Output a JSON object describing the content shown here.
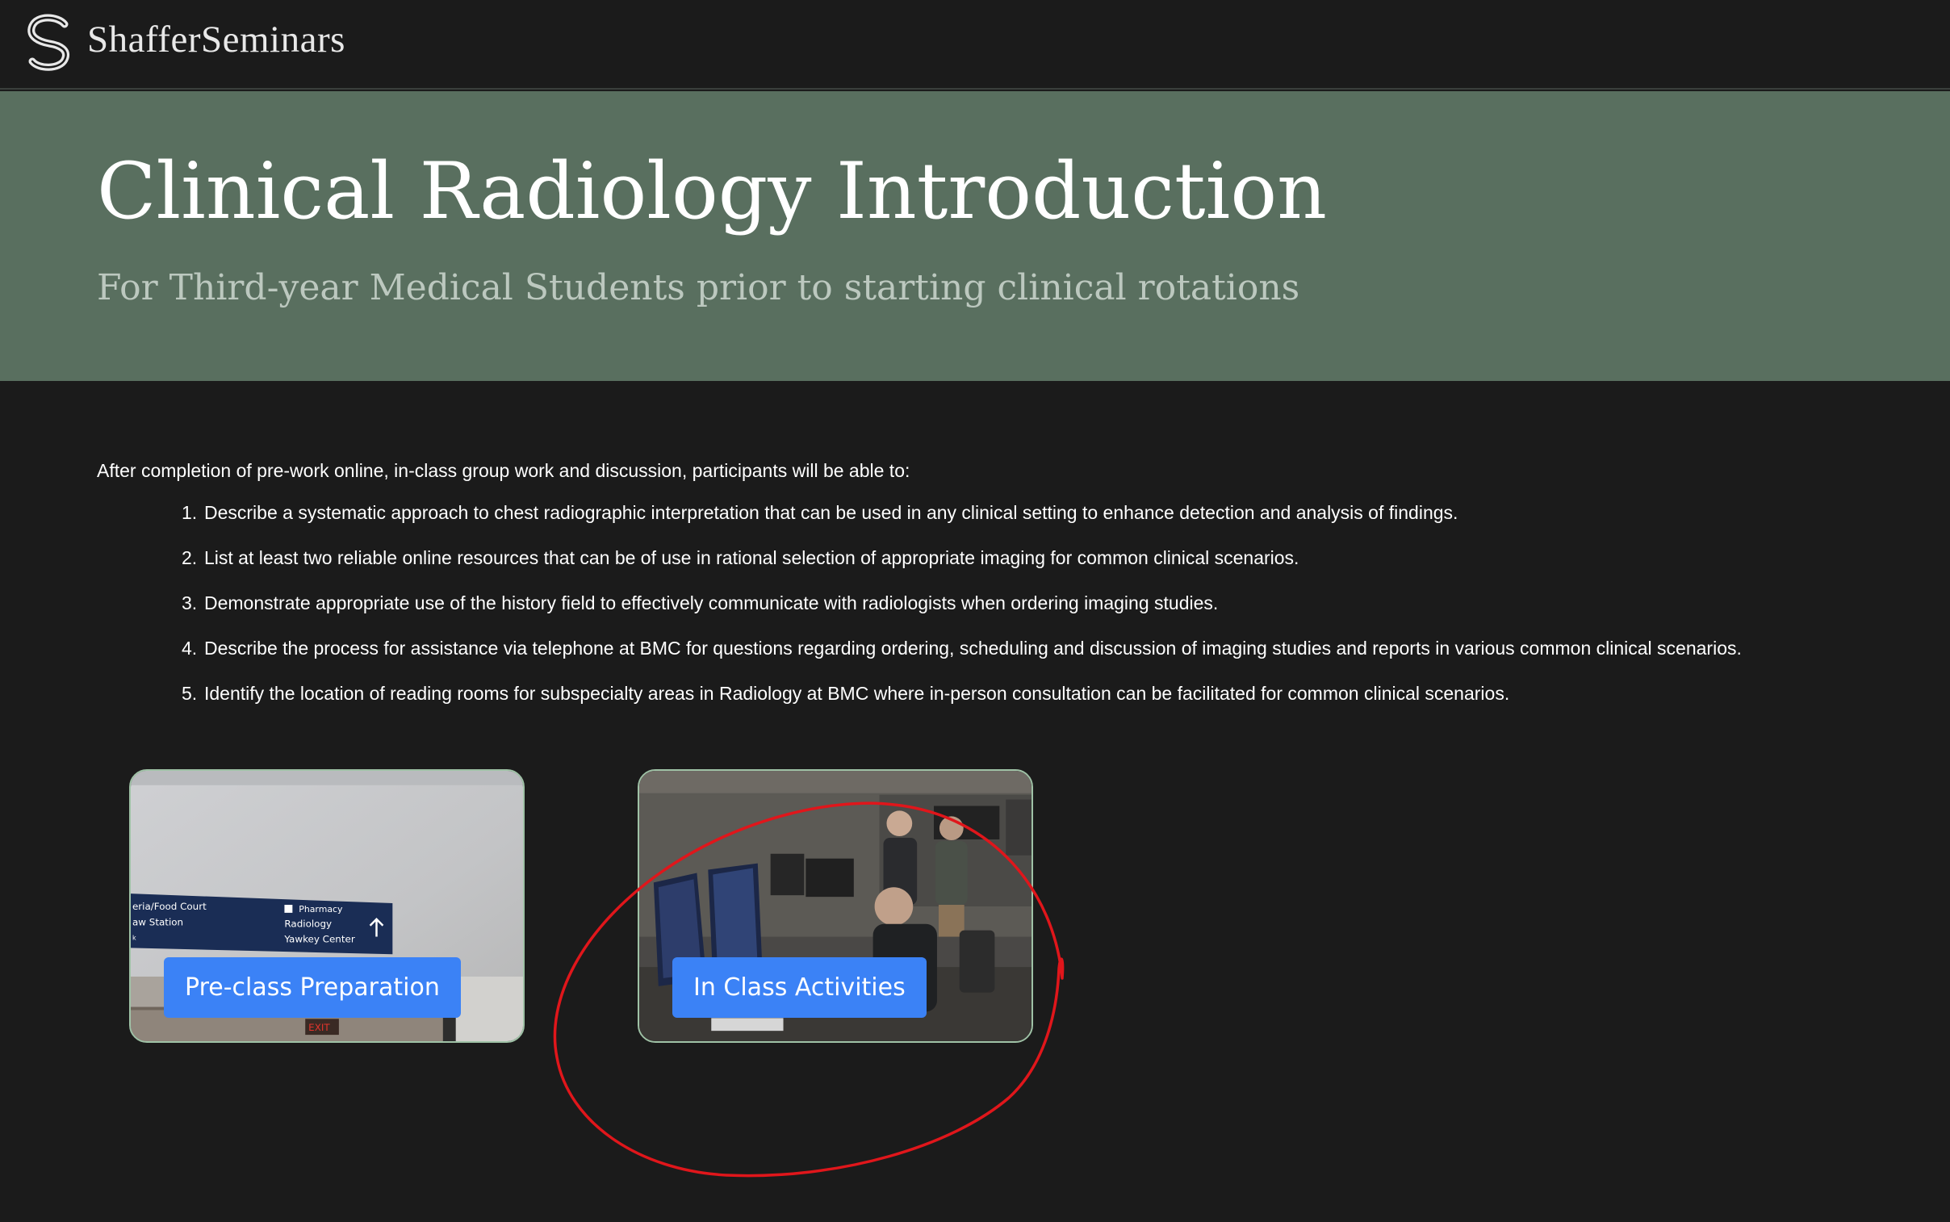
{
  "header": {
    "brand": "ShafferSeminars",
    "logo_icon": "stylized-s-logo"
  },
  "hero": {
    "title": "Clinical Radiology Introduction",
    "subtitle": "For Third-year Medical Students prior to starting clinical rotations"
  },
  "objectives": {
    "intro": "After completion of pre-work online, in-class group work and discussion, participants will be able to:",
    "items": [
      {
        "num": "1.",
        "text": "Describe a systematic approach to chest radiographic interpretation that can be used in any clinical setting to enhance detection and analysis of findings."
      },
      {
        "num": "2.",
        "text": "List at least two reliable online resources that can be of use in rational selection of appropriate imaging for common clinical scenarios."
      },
      {
        "num": "3.",
        "text": "Demonstrate appropriate use of the history field to effectively communicate with radiologists when ordering imaging studies."
      },
      {
        "num": "4.",
        "text": "Describe the process for assistance via telephone at BMC for questions regarding ordering, scheduling and discussion of imaging studies and reports in various common clinical scenarios."
      },
      {
        "num": "5.",
        "text": "Identify the location of reading rooms for subspecialty areas in Radiology at BMC where in-person consultation can be facilitated for common clinical scenarios."
      }
    ]
  },
  "cards": {
    "preclass": {
      "button_label": "Pre-class Preparation",
      "sign": {
        "line1_left": "eria/Food Court",
        "line2_left": "aw Station",
        "line3_left": "k",
        "right1": "Pharmacy",
        "right2": "Radiology",
        "right3": "Yawkey Center",
        "exit": "EXIT"
      }
    },
    "inclass": {
      "button_label": "In Class Activities"
    }
  },
  "colors": {
    "page_bg": "#1b1b1b",
    "hero_bg": "#596f5f",
    "button_bg": "#3b82f6",
    "card_border": "#9fc2a6",
    "annotation": "#e0161b"
  }
}
